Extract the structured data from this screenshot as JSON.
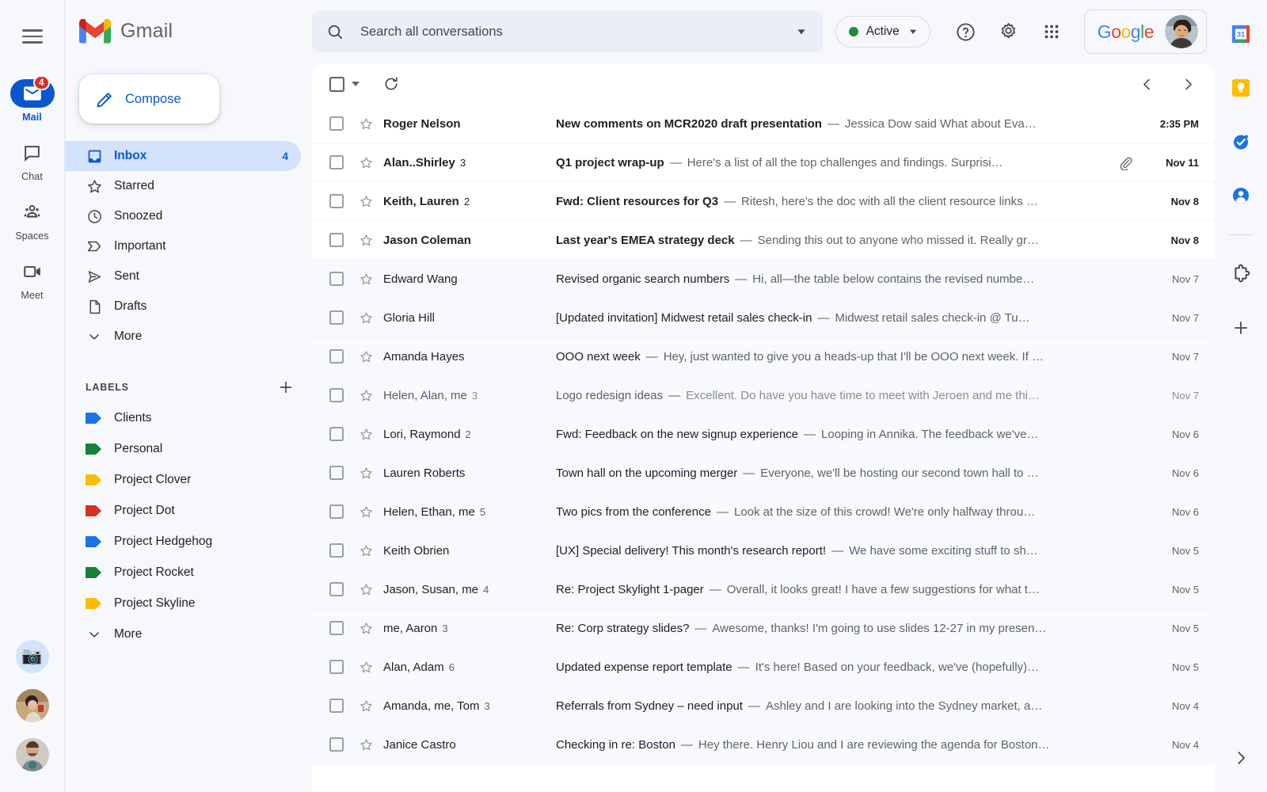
{
  "rail": {
    "menu_icon": "hamburger-menu-icon",
    "items": [
      {
        "label": "Mail",
        "icon": "mail-icon",
        "active": true,
        "badge": "4"
      },
      {
        "label": "Chat",
        "icon": "chat-icon",
        "active": false,
        "badge": ""
      },
      {
        "label": "Spaces",
        "icon": "spaces-icon",
        "active": false,
        "badge": ""
      },
      {
        "label": "Meet",
        "icon": "meet-icon",
        "active": false,
        "badge": ""
      }
    ],
    "avatars": [
      {
        "name": "camera-avatar",
        "glyph": "📷"
      },
      {
        "name": "user-avatar-woman",
        "glyph": ""
      },
      {
        "name": "user-avatar-man",
        "glyph": ""
      }
    ]
  },
  "sidebar": {
    "brand": "Gmail",
    "compose_label": "Compose",
    "folders": [
      {
        "label": "Inbox",
        "icon": "inbox-icon",
        "count": "4",
        "selected": true
      },
      {
        "label": "Starred",
        "icon": "star-icon",
        "count": "",
        "selected": false
      },
      {
        "label": "Snoozed",
        "icon": "clock-icon",
        "count": "",
        "selected": false
      },
      {
        "label": "Important",
        "icon": "important-icon",
        "count": "",
        "selected": false
      },
      {
        "label": "Sent",
        "icon": "send-icon",
        "count": "",
        "selected": false
      },
      {
        "label": "Drafts",
        "icon": "draft-icon",
        "count": "",
        "selected": false
      },
      {
        "label": "More",
        "icon": "chevron-down-icon",
        "count": "",
        "selected": false
      }
    ],
    "labels_title": "LABELS",
    "add_label_icon": "plus-icon",
    "labels": [
      {
        "label": "Clients",
        "color": "#1a73e8"
      },
      {
        "label": "Personal",
        "color": "#188038"
      },
      {
        "label": "Project Clover",
        "color": "#fbbc04"
      },
      {
        "label": "Project Dot",
        "color": "#d93025"
      },
      {
        "label": "Project Hedgehog",
        "color": "#1a73e8"
      },
      {
        "label": "Project Rocket",
        "color": "#188038"
      },
      {
        "label": "Project Skyline",
        "color": "#fbbc04"
      }
    ],
    "labels_more": "More"
  },
  "search": {
    "placeholder": "Search all conversations",
    "search_icon": "search-icon",
    "options_icon": "search-options-icon"
  },
  "header": {
    "status_label": "Active",
    "status_color": "#1e8e3e",
    "help_icon": "help-icon",
    "settings_icon": "gear-icon",
    "apps_icon": "apps-grid-icon",
    "google_word": "Google",
    "avatar": "account-avatar"
  },
  "toolbar": {
    "select_all_icon": "select-all-checkbox",
    "select_dropdown_icon": "chevron-down-icon",
    "refresh_icon": "refresh-icon",
    "prev_icon": "chevron-left-icon",
    "next_icon": "chevron-right-icon"
  },
  "emails": [
    {
      "sender": "Roger Nelson",
      "count": "",
      "subject": "New comments on MCR2020 draft presentation",
      "snippet": "Jessica Dow said What about Eva…",
      "date": "2:35 PM",
      "unread": true,
      "attachment": false,
      "faded": false
    },
    {
      "sender": "Alan..Shirley",
      "count": "3",
      "subject": "Q1 project wrap-up",
      "snippet": "Here's a list of all the top challenges and findings. Surprisi…",
      "date": "Nov 11",
      "unread": true,
      "attachment": true,
      "faded": false
    },
    {
      "sender": "Keith, Lauren",
      "count": "2",
      "subject": "Fwd: Client resources for Q3",
      "snippet": "Ritesh, here's the doc with all the client resource links …",
      "date": "Nov 8",
      "unread": true,
      "attachment": false,
      "faded": false
    },
    {
      "sender": "Jason Coleman",
      "count": "",
      "subject": "Last year's EMEA strategy deck",
      "snippet": "Sending this out to anyone who missed it. Really gr…",
      "date": "Nov 8",
      "unread": true,
      "attachment": false,
      "faded": false
    },
    {
      "sender": "Edward Wang",
      "count": "",
      "subject": "Revised organic search numbers",
      "snippet": "Hi, all—the table below contains the revised numbe…",
      "date": "Nov 7",
      "unread": false,
      "attachment": false,
      "faded": false
    },
    {
      "sender": "Gloria Hill",
      "count": "",
      "subject": "[Updated invitation] Midwest retail sales check-in",
      "snippet": "Midwest retail sales check-in @ Tu…",
      "date": "Nov 7",
      "unread": false,
      "attachment": false,
      "faded": false
    },
    {
      "sender": "Amanda Hayes",
      "count": "",
      "subject": "OOO next week",
      "snippet": "Hey, just wanted to give you a heads-up that I'll be OOO next week. If …",
      "date": "Nov 7",
      "unread": false,
      "attachment": false,
      "faded": false
    },
    {
      "sender": "Helen, Alan, me",
      "count": "3",
      "subject": "Logo redesign ideas",
      "snippet": "Excellent. Do have you have time to meet with Jeroen and me thi…",
      "date": "Nov 7",
      "unread": false,
      "attachment": false,
      "faded": true
    },
    {
      "sender": "Lori, Raymond",
      "count": "2",
      "subject": "Fwd: Feedback on the new signup experience",
      "snippet": "Looping in Annika. The feedback we've…",
      "date": "Nov 6",
      "unread": false,
      "attachment": false,
      "faded": false
    },
    {
      "sender": "Lauren Roberts",
      "count": "",
      "subject": "Town hall on the upcoming merger",
      "snippet": "Everyone, we'll be hosting our second town hall to …",
      "date": "Nov 6",
      "unread": false,
      "attachment": false,
      "faded": false
    },
    {
      "sender": "Helen, Ethan, me",
      "count": "5",
      "subject": "Two pics from the conference",
      "snippet": "Look at the size of this crowd! We're only halfway throu…",
      "date": "Nov 6",
      "unread": false,
      "attachment": false,
      "faded": false
    },
    {
      "sender": "Keith Obrien",
      "count": "",
      "subject": "[UX] Special delivery! This month's research report!",
      "snippet": "We have some exciting stuff to sh…",
      "date": "Nov 5",
      "unread": false,
      "attachment": false,
      "faded": false
    },
    {
      "sender": "Jason, Susan, me",
      "count": "4",
      "subject": "Re: Project Skylight 1-pager",
      "snippet": "Overall, it looks great! I have a few suggestions for what t…",
      "date": "Nov 5",
      "unread": false,
      "attachment": false,
      "faded": false
    },
    {
      "sender": "me, Aaron",
      "count": "3",
      "subject": "Re: Corp strategy slides?",
      "snippet": "Awesome, thanks! I'm going to use slides 12-27 in my presen…",
      "date": "Nov 5",
      "unread": false,
      "attachment": false,
      "faded": false
    },
    {
      "sender": "Alan, Adam",
      "count": "6",
      "subject": "Updated expense report template",
      "snippet": "It's here! Based on your feedback, we've (hopefully)…",
      "date": "Nov 5",
      "unread": false,
      "attachment": false,
      "faded": false
    },
    {
      "sender": "Amanda, me, Tom",
      "count": "3",
      "subject": "Referrals from Sydney – need input",
      "snippet": "Ashley and I are looking into the Sydney market, a…",
      "date": "Nov 4",
      "unread": false,
      "attachment": false,
      "faded": false
    },
    {
      "sender": "Janice Castro",
      "count": "",
      "subject": "Checking in re: Boston",
      "snippet": "Hey there. Henry Liou and I are reviewing the agenda for Boston…",
      "date": "Nov 4",
      "unread": false,
      "attachment": false,
      "faded": false
    }
  ],
  "side_panel": {
    "items": [
      {
        "icon": "google-calendar-icon"
      },
      {
        "icon": "google-keep-icon"
      },
      {
        "icon": "google-tasks-icon"
      },
      {
        "icon": "google-contacts-icon"
      }
    ],
    "addons": [
      {
        "icon": "marketplace-addons-icon"
      },
      {
        "icon": "plus-icon"
      }
    ],
    "expand_icon": "chevron-right-icon"
  }
}
